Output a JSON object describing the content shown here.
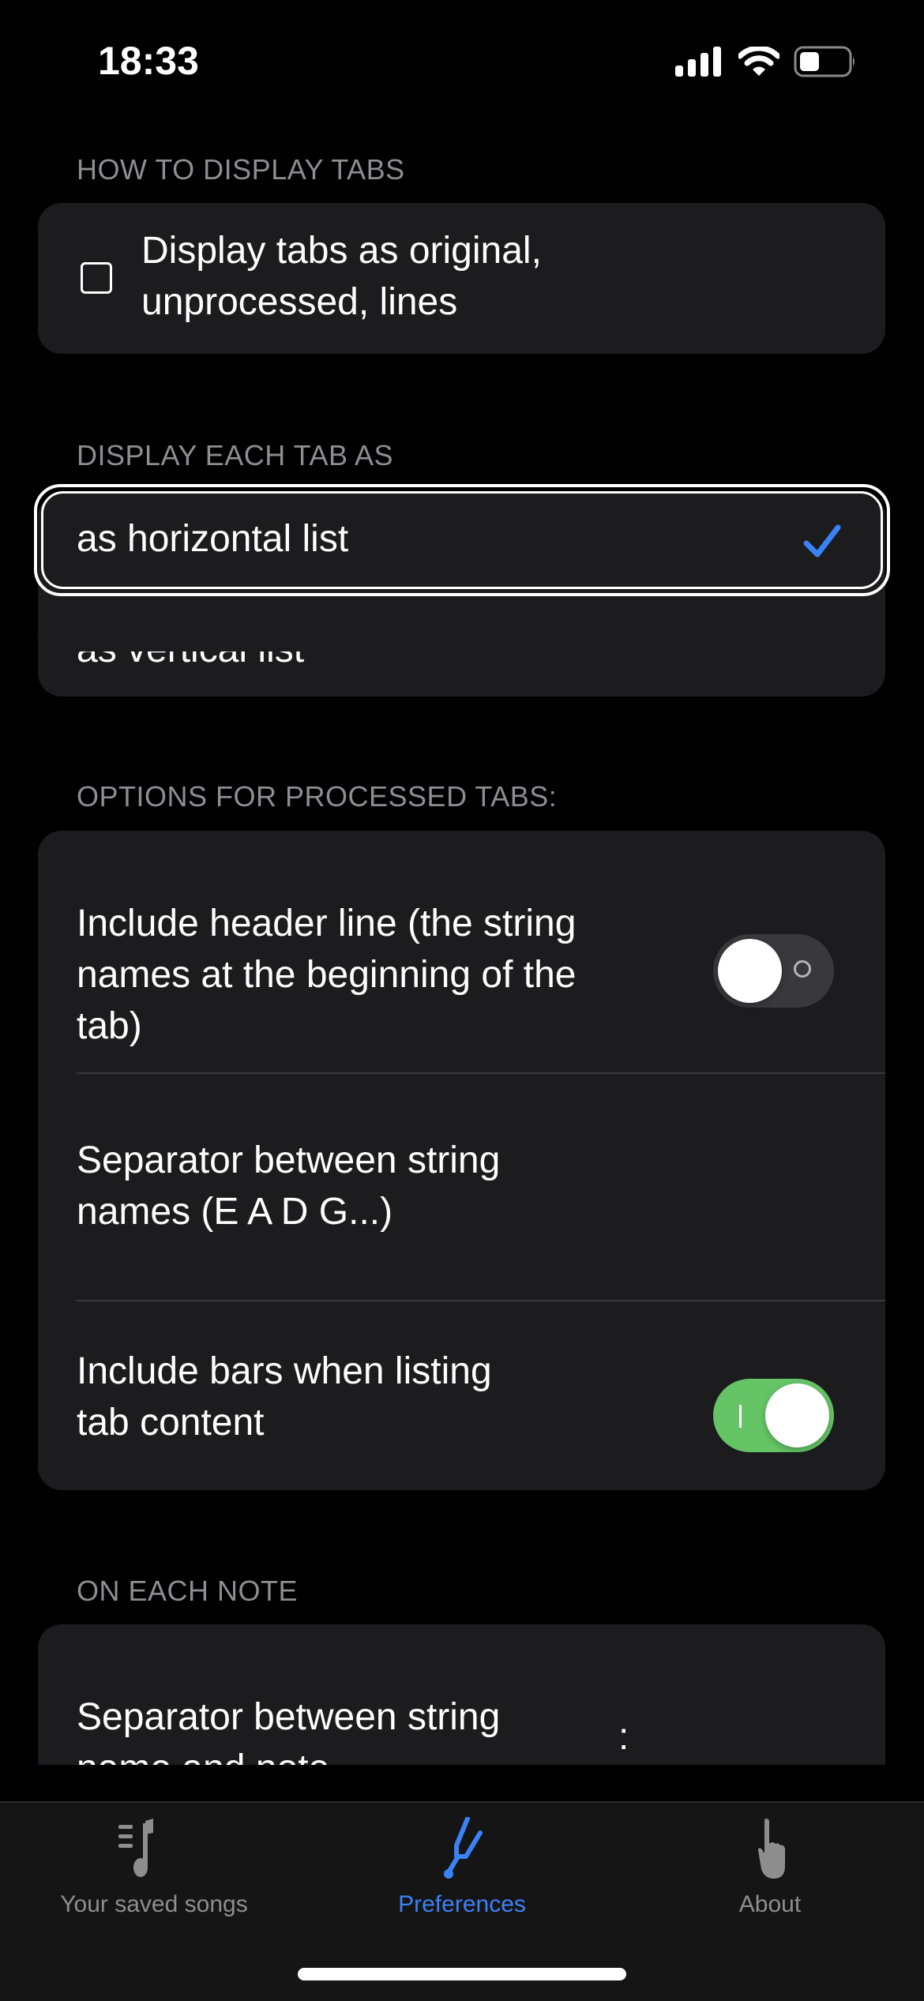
{
  "status_bar": {
    "time": "18:33",
    "signal_icon": "cellular-signal-icon",
    "wifi_icon": "wifi-icon",
    "battery_icon": "battery-icon",
    "battery_level": 0.35
  },
  "sections": {
    "display_tabs": {
      "header": "HOW TO DISPLAY TABS",
      "checkbox_label_line1": "Display tabs as original,",
      "checkbox_label_line2": "unprocessed, lines",
      "checked": false
    },
    "display_each_tab": {
      "header": "DISPLAY EACH TAB AS",
      "options": [
        {
          "label": "as horizontal list",
          "selected": true
        },
        {
          "label": "as vertical list",
          "selected": false
        }
      ]
    },
    "processed_options": {
      "header": "OPTIONS FOR PROCESSED TABS:",
      "rows": [
        {
          "line1": "Include header line (the string",
          "line2": "names at the beginning of the",
          "line3": "tab)",
          "toggle": false
        },
        {
          "line1": "Separator between string",
          "line2": "names (E A D G...)",
          "value": ""
        },
        {
          "line1": "Include bars when listing",
          "line2": "tab content",
          "toggle": true
        }
      ]
    },
    "on_each_note": {
      "header": "ON EACH NOTE",
      "rows": [
        {
          "line1": "Separator between string",
          "line2": "name and note",
          "value": ":"
        }
      ]
    }
  },
  "tab_bar": {
    "items": [
      {
        "label": "Your saved songs",
        "icon": "music-list-icon",
        "active": false
      },
      {
        "label": "Preferences",
        "icon": "tuning-fork-icon",
        "active": true
      },
      {
        "label": "About",
        "icon": "hand-pointer-icon",
        "active": false
      }
    ]
  },
  "colors": {
    "accent": "#3a82f7",
    "toggle_on": "#65c466",
    "toggle_off": "#39393d",
    "card": "#1c1c1e",
    "section_header": "#8d8d92"
  }
}
